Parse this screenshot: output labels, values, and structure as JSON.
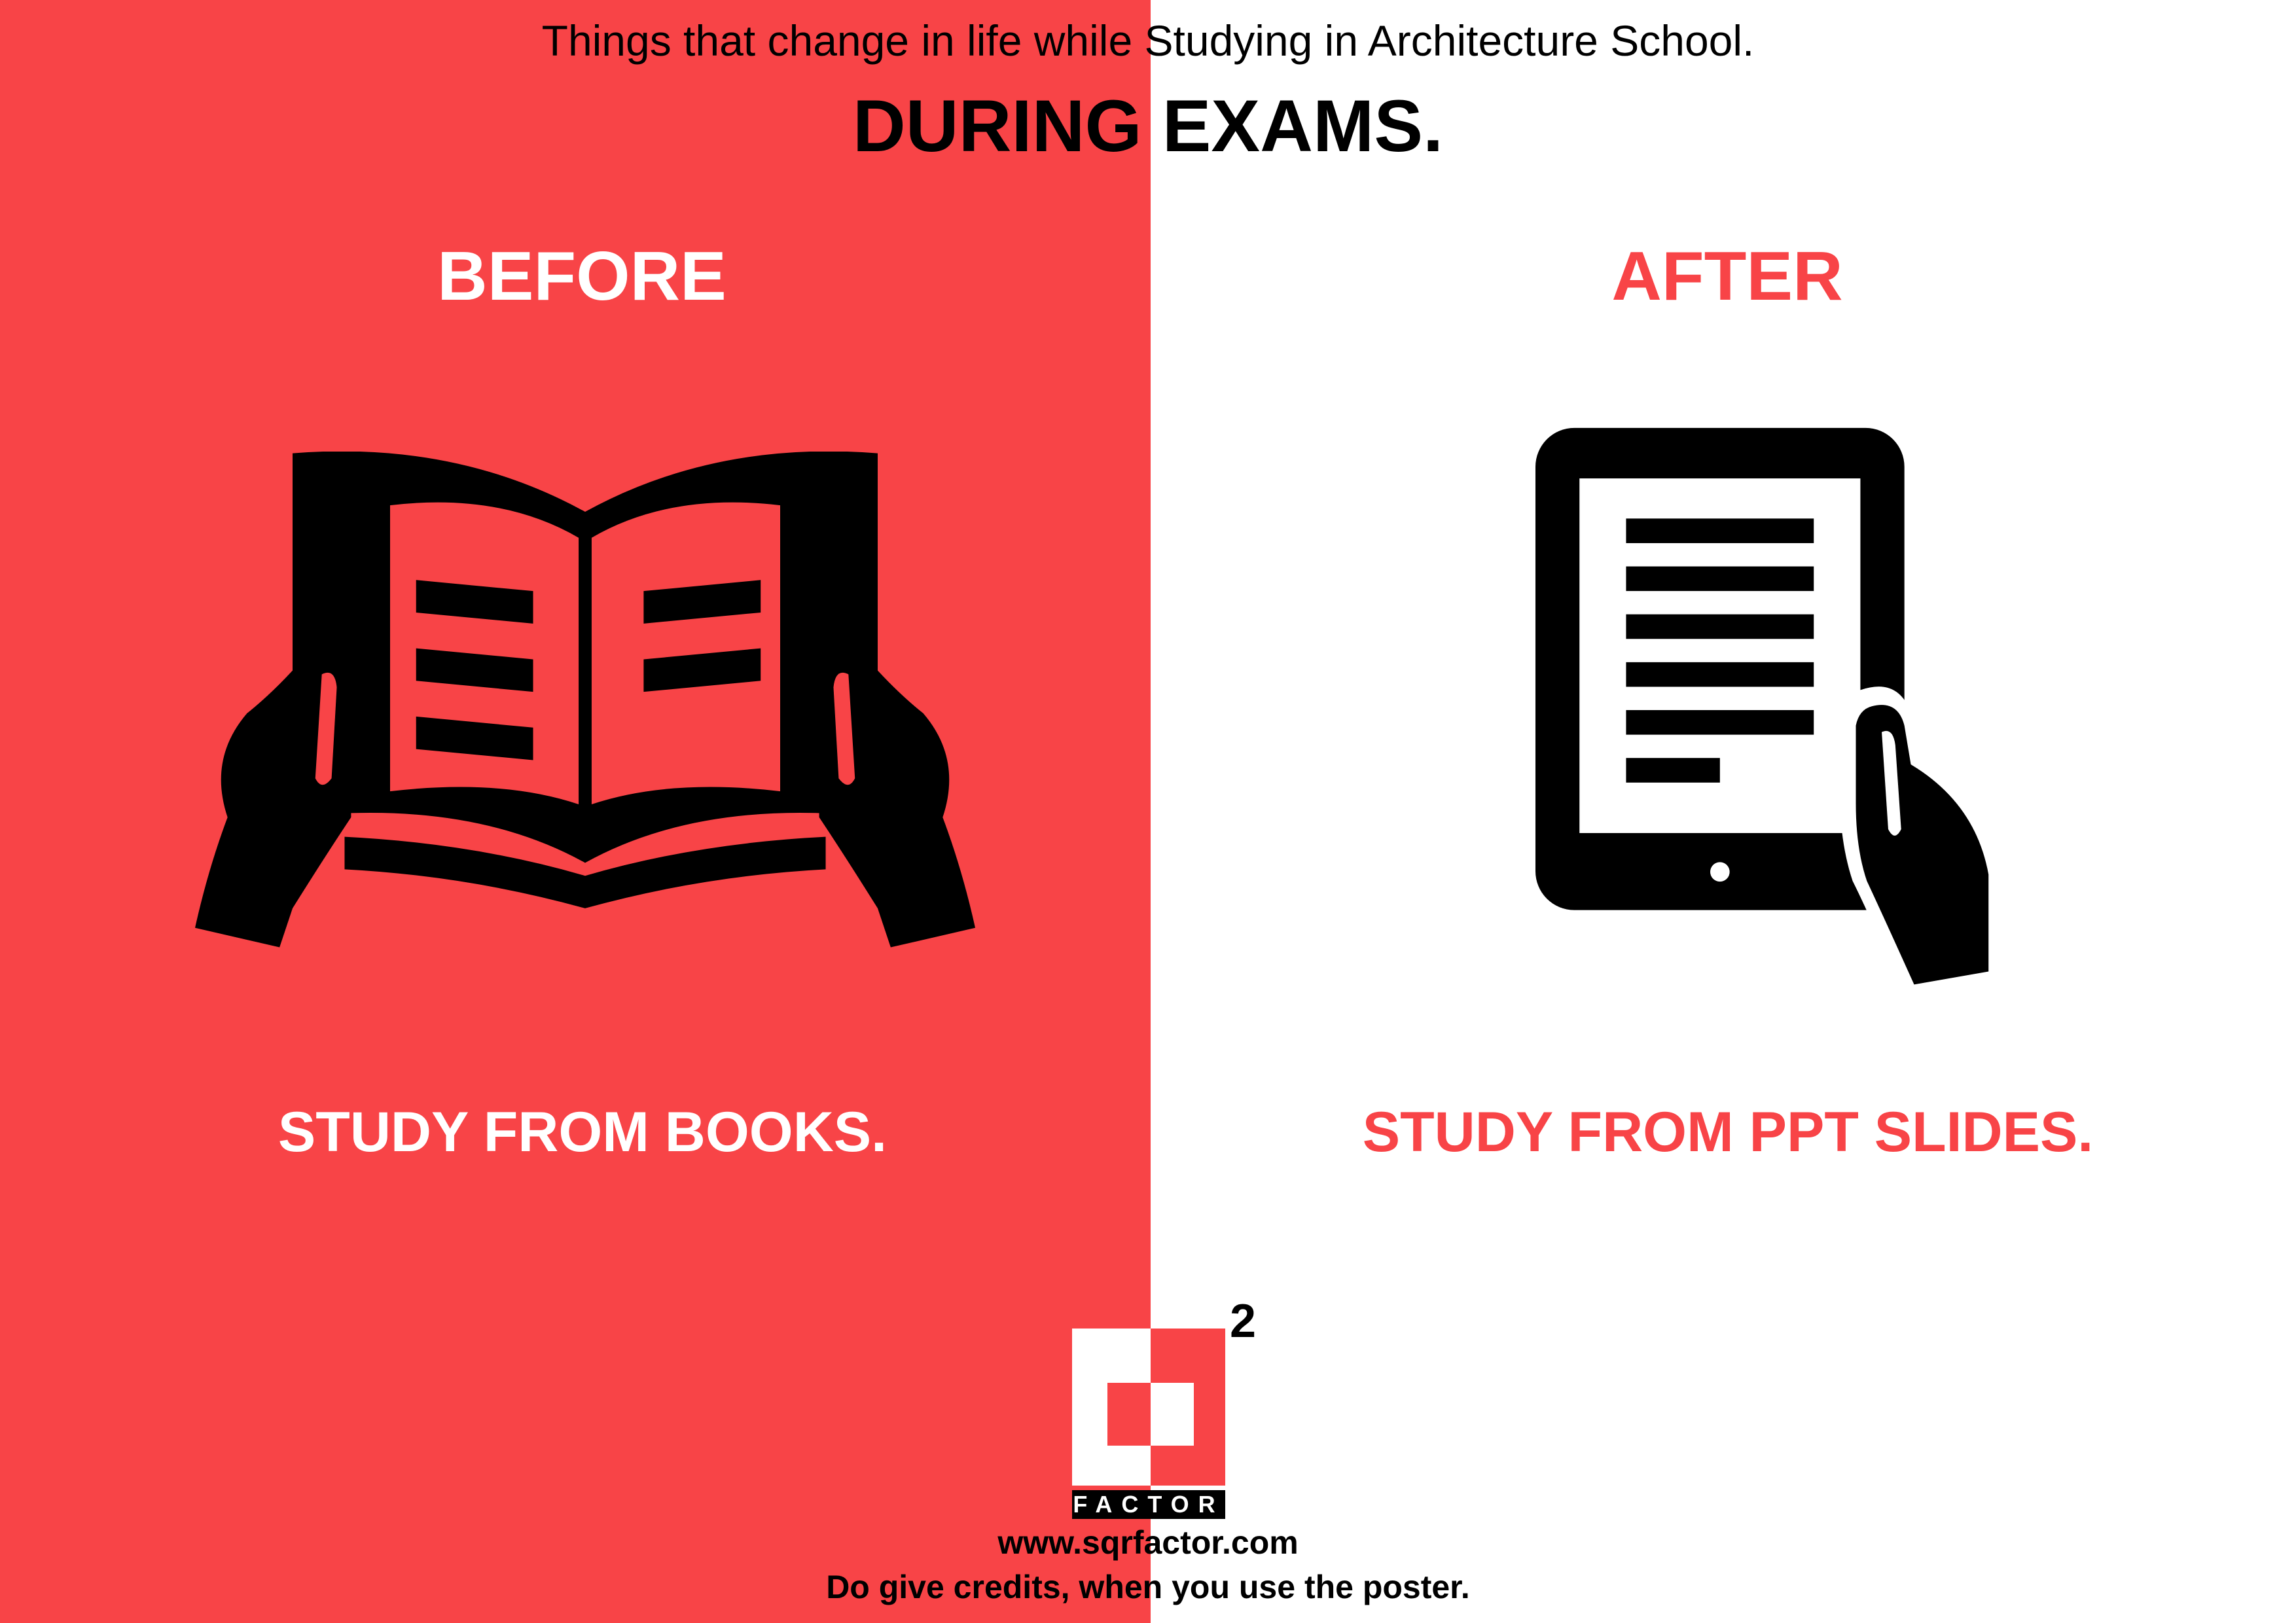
{
  "poster": {
    "subtitle": "Things that change in life while Studying in Architecture School.",
    "title": "DURING EXAMS.",
    "before": {
      "heading": "BEFORE",
      "caption": "STUDY FROM BOOKS.",
      "icon": "open-book-with-hands"
    },
    "after": {
      "heading": "AFTER",
      "caption": "STUDY FROM PPT SLIDES.",
      "icon": "tablet-in-hand"
    },
    "logo": {
      "superscript": "2",
      "wordmark": "FACTOR"
    },
    "website": "www.sqrfactor.com",
    "credits": "Do give credits, when you use the poster."
  },
  "colors": {
    "accent": "#F84447",
    "background": "#FFFFFF",
    "ink": "#000000"
  }
}
